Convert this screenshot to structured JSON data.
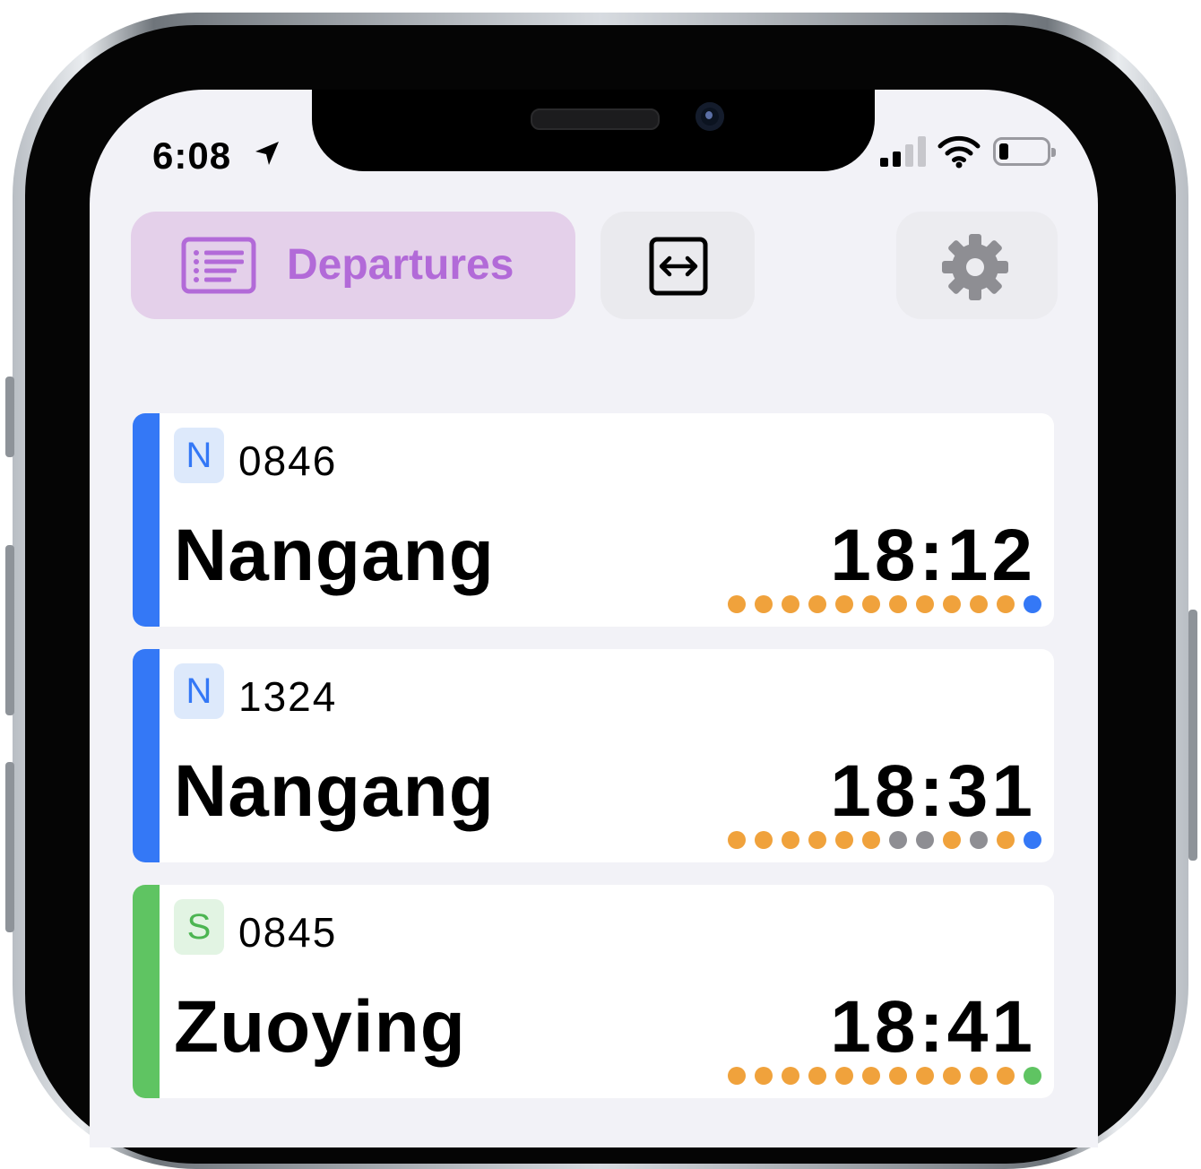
{
  "status_bar": {
    "time": "6:08",
    "battery_level": 0.2,
    "signal_bars": 2
  },
  "tabs": {
    "departures_label": "Departures",
    "departures_icon": "list-icon",
    "swap_icon": "swap-horizontal-icon",
    "settings_icon": "gear-icon"
  },
  "colors": {
    "orange": "#f0a23c",
    "gray": "#8e8e93",
    "blue": "#3478f6",
    "green": "#5fc462"
  },
  "departures": [
    {
      "type": "N",
      "number": "0846",
      "destination": "Nangang",
      "time": "18:12",
      "line_color": "#3478f6",
      "badge_bg": "#dde9fb",
      "badge_color": "#3478f6",
      "stops": [
        "orange",
        "orange",
        "orange",
        "orange",
        "orange",
        "orange",
        "orange",
        "orange",
        "orange",
        "orange",
        "orange",
        "blue"
      ]
    },
    {
      "type": "N",
      "number": "1324",
      "destination": "Nangang",
      "time": "18:31",
      "line_color": "#3478f6",
      "badge_bg": "#dde9fb",
      "badge_color": "#3478f6",
      "stops": [
        "orange",
        "orange",
        "orange",
        "orange",
        "orange",
        "orange",
        "gray",
        "gray",
        "orange",
        "gray",
        "orange",
        "blue"
      ]
    },
    {
      "type": "S",
      "number": "0845",
      "destination": "Zuoying",
      "time": "18:41",
      "line_color": "#5fc462",
      "badge_bg": "#e2f4e3",
      "badge_color": "#4cb552",
      "stops": [
        "orange",
        "orange",
        "orange",
        "orange",
        "orange",
        "orange",
        "orange",
        "orange",
        "orange",
        "orange",
        "orange",
        "green"
      ]
    }
  ]
}
